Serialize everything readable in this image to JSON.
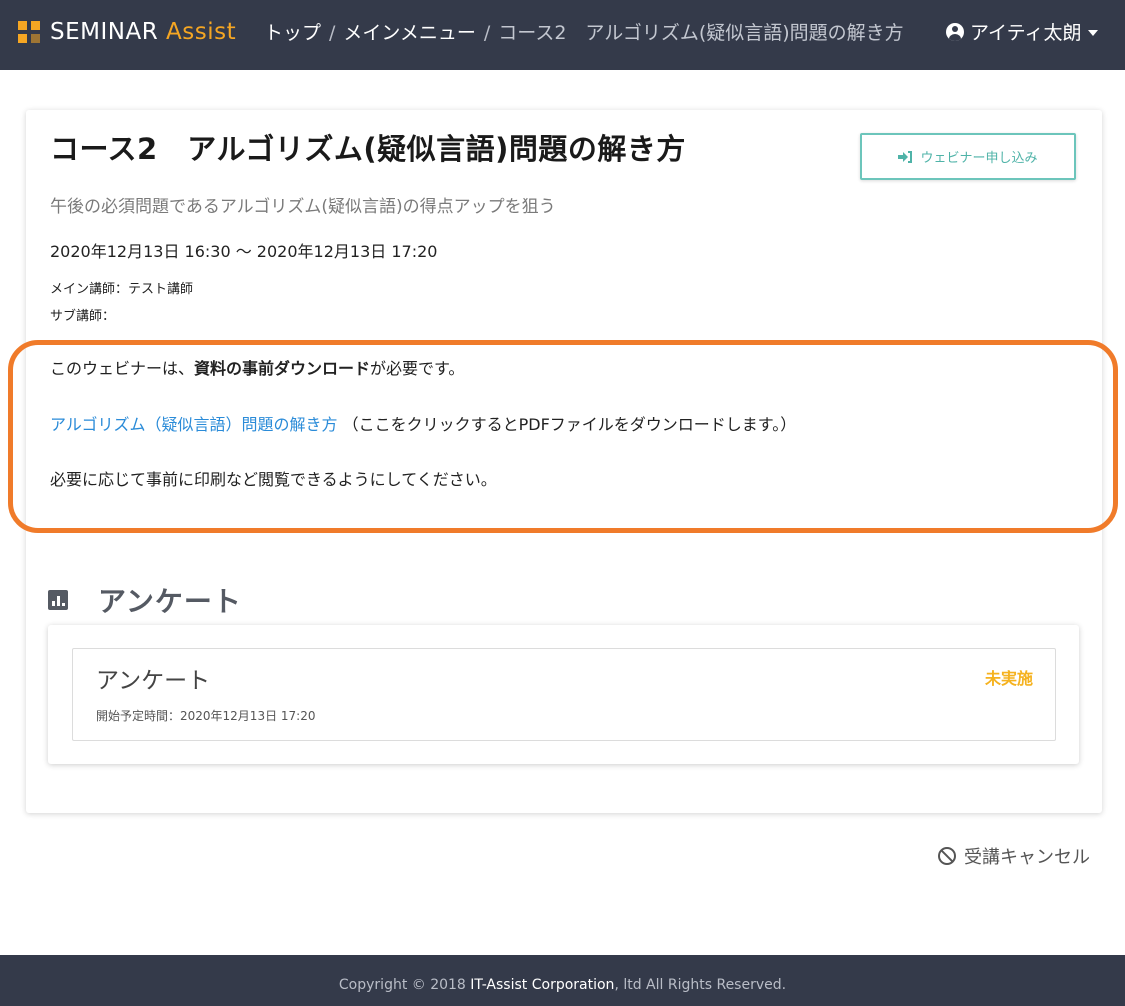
{
  "brand": {
    "name_main": "SEMINAR",
    "name_accent": "Assist"
  },
  "breadcrumb": {
    "items": [
      "トップ",
      "メインメニュー"
    ],
    "separator": "/",
    "current": "コース2　アルゴリズム(疑似言語)問題の解き方"
  },
  "user": {
    "name": "アイティ太朗"
  },
  "seminar": {
    "title": "コース2　アルゴリズム(疑似言語)問題の解き方",
    "subtitle": "午後の必須問題であるアルゴリズム(疑似言語)の得点アップを狙う",
    "datetime": "2020年12月13日 16:30 ～ 2020年12月13日 17:20",
    "main_lecturer": "メイン講師：テスト講師",
    "sub_lecturer": "サブ講師："
  },
  "webinar_button": {
    "label": "ウェビナー申し込み"
  },
  "notice": {
    "prefix": "このウェビナーは、",
    "bold": "資料の事前ダウンロード",
    "suffix": "が必要です。",
    "pdf_link": "アルゴリズム（疑似言語）問題の解き方",
    "pdf_note": "（ここをクリックするとPDFファイルをダウンロードします。）",
    "print_note": "必要に応じて事前に印刷など閲覧できるようにしてください。"
  },
  "survey": {
    "heading": "アンケート",
    "item_title": "アンケート",
    "status": "未実施",
    "start_time": "開始予定時間：2020年12月13日 17:20"
  },
  "cancel": {
    "label": "受講キャンセル"
  },
  "footer": {
    "prefix": "Copyright © 2018 ",
    "company": "IT-Assist Corporation",
    "suffix": ", ltd All Rights Reserved."
  },
  "colors": {
    "navbar": "#343a4a",
    "brand_accent": "#f5a623",
    "button_teal": "#4fb3a8",
    "link_blue": "#2a8bd8",
    "highlight_orange": "#f07b2a",
    "status_yellow": "#f5b21f"
  },
  "icons": [
    "logo-grid-icon",
    "user-circle-icon",
    "chevron-down-icon",
    "sign-in-icon",
    "bar-chart-icon",
    "ban-icon"
  ]
}
